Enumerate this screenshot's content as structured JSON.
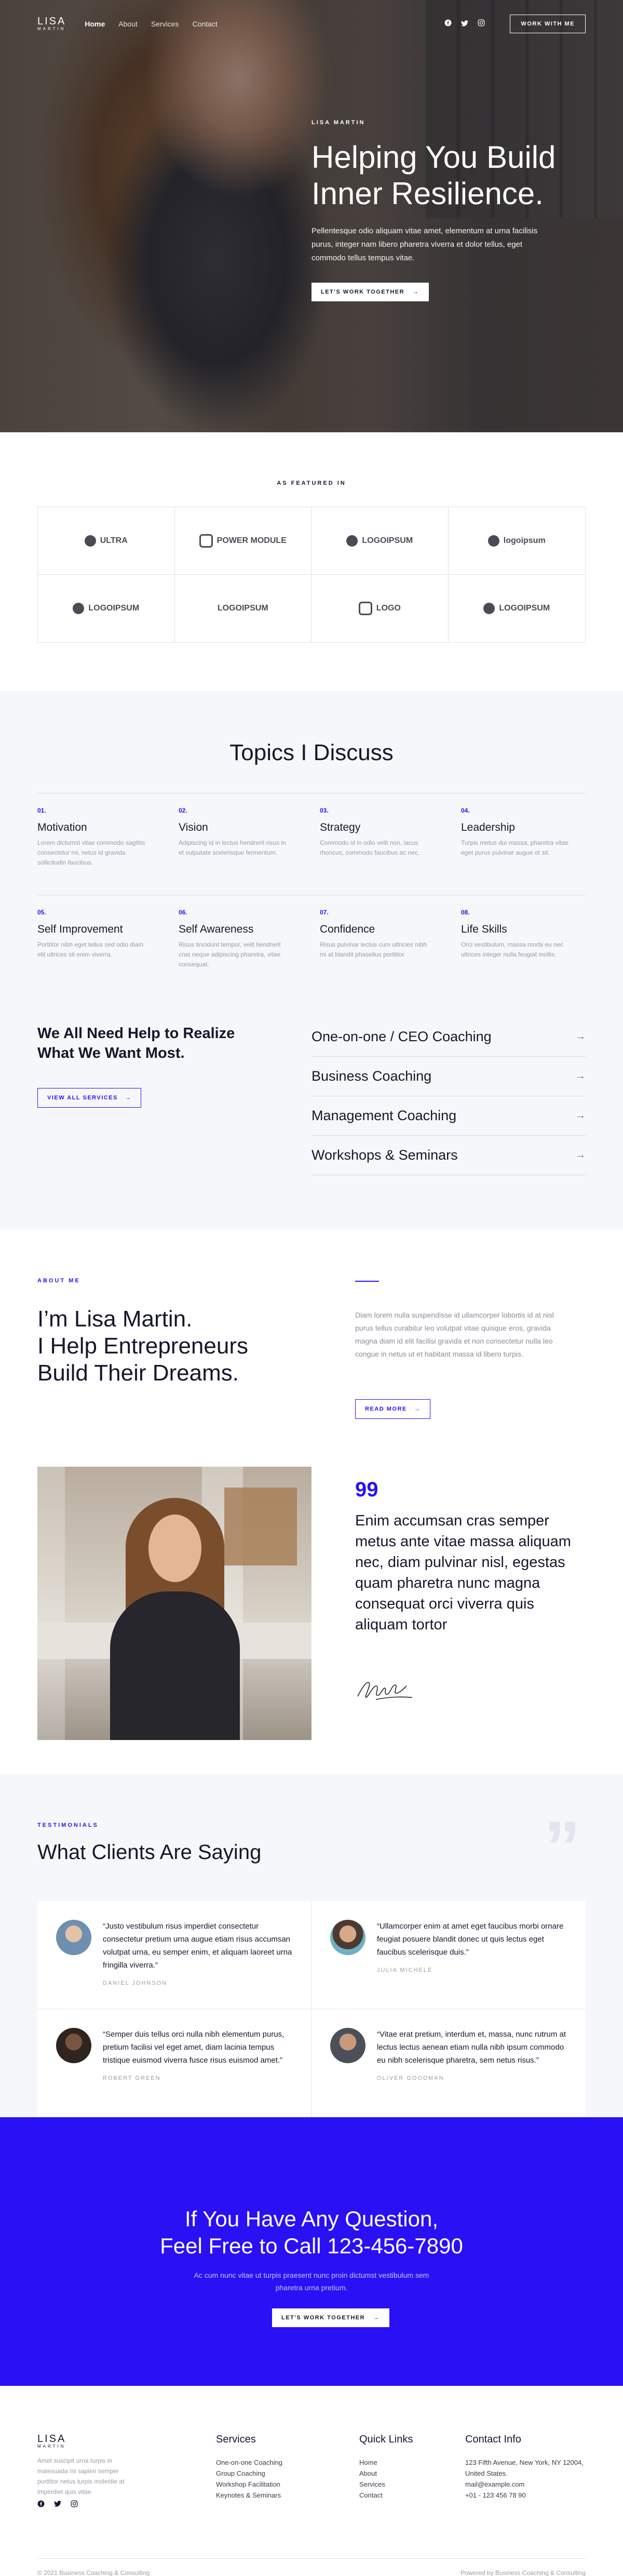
{
  "nav": {
    "logo_main": "LISA",
    "logo_sub": "MARTIN",
    "links": [
      "Home",
      "About",
      "Services",
      "Contact"
    ],
    "socials": [
      "facebook-icon",
      "twitter-icon",
      "instagram-icon"
    ],
    "cta": "WORK WITH ME"
  },
  "hero": {
    "kicker": "LISA MARTIN",
    "title": "Helping You Build Inner Resilience.",
    "text": "Pellentesque odio aliquam vitae amet, elementum at urna facilisis purus, integer nam libero pharetra viverra et dolor tellus, eget commodo tellus tempus vitae.",
    "button": "LET'S WORK TOGETHER",
    "arrow": "→"
  },
  "featured": {
    "label": "AS FEATURED IN",
    "logos": [
      "ULTRA",
      "POWER MODULE",
      "LOGOIPSUM",
      "logoipsum",
      "LOGOIPSUM",
      "LOGOIPSUM",
      "LOGO",
      "LOGOIPSUM"
    ]
  },
  "topics": {
    "title": "Topics I Discuss",
    "items": [
      {
        "num": "01.",
        "title": "Motivation",
        "text": "Lorem dictumst vitae commodo sagittis consectetur mi, netus id gravida sollicitudin faucibus."
      },
      {
        "num": "02.",
        "title": "Vision",
        "text": "Adipiscing id in lectus hendrerit risus in et vulputate scelerisque fermentum."
      },
      {
        "num": "03.",
        "title": "Strategy",
        "text": "Commodo id in odio velit non, lacus rhoncus, commodo faucibus ac nec."
      },
      {
        "num": "04.",
        "title": "Leadership",
        "text": "Turpis metus dui massa, pharetra vitae eget purus pulvinar augue et sit."
      },
      {
        "num": "05.",
        "title": "Self Improvement",
        "text": "Porttitor nibh eget tellus sed odio diam elit ultrices sit enim viverra."
      },
      {
        "num": "06.",
        "title": "Self Awareness",
        "text": "Risus tincidunt tempor, velit hendrerit cras neque adipiscing pharetra, vitae consequat."
      },
      {
        "num": "07.",
        "title": "Confidence",
        "text": "Risus pulvinar lectus cum ultricies nibh mi at blandit phasellus porttitor."
      },
      {
        "num": "08.",
        "title": "Life Skills",
        "text": "Orci vestibulum, massa morbi eu nec ultrices integer nulla feugiat mollis."
      }
    ],
    "help_title": "We All Need Help to Realize What We Want Most.",
    "help_button": "VIEW ALL SERVICES",
    "services": [
      "One-on-one / CEO Coaching",
      "Business Coaching",
      "Management Coaching",
      "Workshops & Seminars"
    ]
  },
  "about": {
    "kicker": "ABOUT ME",
    "title_1": "I’m Lisa Martin.",
    "title_2": "I Help Entrepreneurs",
    "title_3": "Build Their Dreams.",
    "bio": "Diam lorem nulla suspendisse id ullamcorper lobortis id at nisl purus tellus curabitur leo volutpat vitae quisque eros, gravida magna diam id elit facilisi gravida et non consectetur nulla leo congue in netus ut et habitant massa id libero turpis.",
    "button": "READ MORE",
    "quote_mark": "99",
    "quote": "Enim accumsan cras semper metus ante vitae massa aliquam nec, diam pulvinar nisl, egestas quam pharetra nunc magna consequat orci viverra quis aliquam tortor"
  },
  "testimonials": {
    "kicker": "TESTIMONIALS",
    "title": "What Clients Are Saying",
    "items": [
      {
        "quote": "“Justo vestibulum risus imperdiet consectetur consectetur pretium urna augue etiam risus accumsan volutpat urna, eu semper enim, et aliquam laoreet urna fringilla viverra.”",
        "name": "DANIEL JOHNSON"
      },
      {
        "quote": "“Ullamcorper enim at amet eget faucibus morbi ornare feugiat posuere blandit donec ut quis lectus eget faucibus scelerisque duis.”",
        "name": "JULIA MICHELE"
      },
      {
        "quote": "“Semper duis tellus orci nulla nibh elementum purus, pretium facilisi vel eget amet, diam lacinia tempus tristique euismod viverra fusce risus euismod amet.”",
        "name": "ROBERT GREEN"
      },
      {
        "quote": "“Vitae erat pretium, interdum et, massa, nunc rutrum at lectus lectus aenean etiam nulla nibh ipsum commodo eu nibh scelerisque pharetra, sem netus risus.”",
        "name": "OLIVER GOODMAN"
      }
    ]
  },
  "cta": {
    "title_1": "If You Have Any Question,",
    "title_2": "Feel Free to Call 123-456-7890",
    "text": "Ac cum nunc vitae ut turpis praesent nunc proin dictumst vestibulum sem pharetra urna pretium.",
    "button": "LET'S WORK TOGETHER"
  },
  "footer": {
    "desc": "Amet suscipit urna turpis in malesuada mi sapien semper porttitor netus turpis molestie at imperdiet quis vitae.",
    "services_title": "Services",
    "services": [
      "One-on-one Coaching",
      "Group Coaching",
      "Workshop Facilitation",
      "Keynotes & Seminars"
    ],
    "links_title": "Quick Links",
    "links": [
      "Home",
      "About",
      "Services",
      "Contact"
    ],
    "contact_title": "Contact Info",
    "contact": [
      "123 Fifth Avenue, New York, NY 12004, United States.",
      "mail@example.com",
      "+01 - 123 456 78 90"
    ],
    "copyright": "© 2021 Business Coaching & Consulting",
    "powered": "Powered by Business Coaching & Consulting"
  },
  "colors": {
    "accent": "#2a10f5",
    "dark": "#16172c",
    "muted": "#9a9aa8",
    "light_bg": "#f6f7fa"
  }
}
